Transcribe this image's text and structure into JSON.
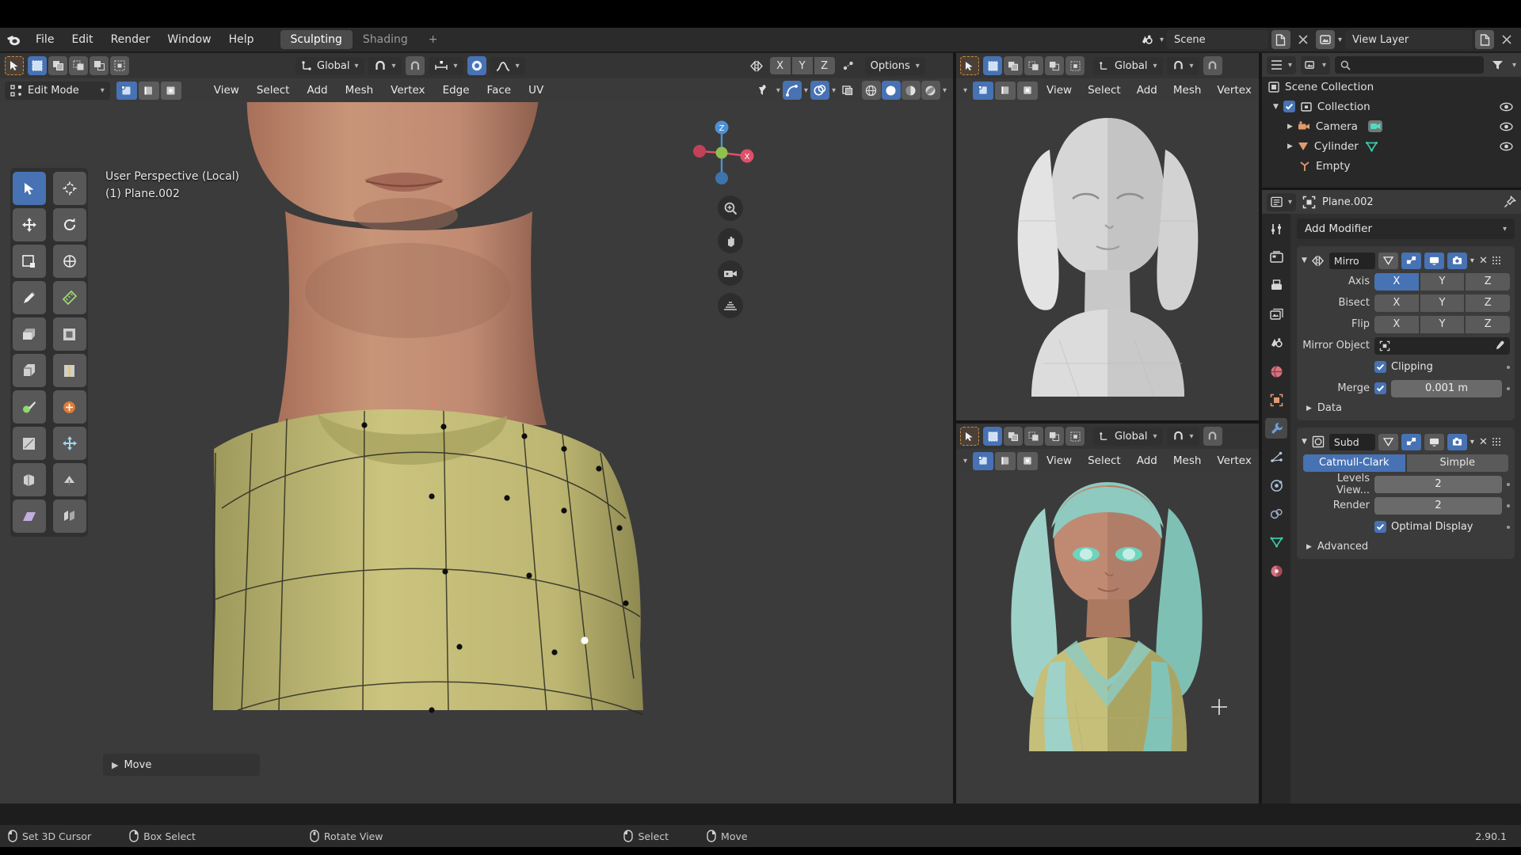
{
  "app": {
    "name": "Blender",
    "version": "2.90.1"
  },
  "topbar": {
    "menus": [
      "File",
      "Edit",
      "Render",
      "Window",
      "Help"
    ],
    "workspaces": [
      {
        "label": "Sculpting",
        "active": true
      },
      {
        "label": "Shading",
        "active": false
      }
    ],
    "add_workspace": "+",
    "scene_field": "Scene",
    "viewlayer_field": "View Layer",
    "scene_icon": "scene-icon",
    "viewlayer_icon": "viewlayer-icon",
    "new_icon": "new-datablock-icon",
    "close_icon": "close-icon"
  },
  "viewport": {
    "tools_header": {
      "cursor_icon": "cursor-select-icon",
      "select_modes": [
        "set-select",
        "extend-select",
        "subtract-select",
        "invert-select",
        "intersect-select"
      ],
      "transform_orientation": "Global",
      "snap_icon": "magnet-icon",
      "snap_target": "snap-increment-icon",
      "proportional_icon": "proportional-editing-icon",
      "falloff_icon": "smooth-falloff-icon",
      "mirror_icon": "mirror-icon",
      "mirror_axes": [
        "X",
        "Y",
        "Z"
      ],
      "autom_icon": "automerge-icon",
      "options_label": "Options"
    },
    "header": {
      "mode": "Edit Mode",
      "select_modes": [
        "vertex-select",
        "edge-select",
        "face-select"
      ],
      "menus": [
        "View",
        "Select",
        "Add",
        "Mesh",
        "Vertex",
        "Edge",
        "Face",
        "UV"
      ],
      "overlay_icons": [
        "visibility-icon",
        "show-gizmo-icon",
        "show-overlays-icon",
        "xray-icon"
      ],
      "shading_modes": [
        "wireframe-shading",
        "solid-shading",
        "material-shading",
        "rendered-shading"
      ]
    },
    "overlay_text": {
      "perspective": "User Perspective (Local)",
      "object": "(1) Plane.002"
    },
    "toolbar_tools": [
      "tweak-tool",
      "cursor-tool",
      "move-tool",
      "rotate-tool",
      "scale-tool",
      "transform-tool",
      "annotate-tool",
      "measure-tool",
      "extrude-region-tool",
      "inset-faces-tool",
      "bevel-tool",
      "loop-cut-tool",
      "knife-tool",
      "poly-build-tool",
      "spin-tool",
      "smooth-tool",
      "edge-slide-tool",
      "shrink-fatten-tool",
      "shear-tool",
      "rip-region-tool"
    ],
    "gizmo_axes": [
      "X",
      "Y",
      "Z"
    ],
    "nav_buttons": [
      "zoom-icon",
      "pan-icon",
      "camera-view-icon",
      "ortho-persp-icon"
    ],
    "operator_panel": "Move"
  },
  "viewport_small_top": {
    "transform_orientation": "Global",
    "menus": [
      "View",
      "Select",
      "Add",
      "Mesh",
      "Vertex"
    ]
  },
  "viewport_small_bottom": {
    "transform_orientation": "Global",
    "menus": [
      "View",
      "Select",
      "Add",
      "Mesh",
      "Vertex"
    ]
  },
  "outliner": {
    "search_placeholder": "",
    "display_mode_icon": "outliner-display-icon",
    "filter_icon": "filter-icon",
    "rows": [
      {
        "label": "Scene Collection",
        "indent": 0,
        "icon": "scene-collection-icon",
        "checkbox": false,
        "eye": false
      },
      {
        "label": "Collection",
        "indent": 1,
        "icon": "collection-icon",
        "checkbox": true,
        "eye": true
      },
      {
        "label": "Camera",
        "indent": 2,
        "icon": "camera-icon",
        "checkbox": false,
        "eye": true,
        "data_icon": "camera-data-icon"
      },
      {
        "label": "Cylinder",
        "indent": 2,
        "icon": "mesh-object-icon",
        "checkbox": false,
        "eye": true,
        "data_icon": "mesh-data-icon"
      },
      {
        "label": "Empty",
        "indent": 2,
        "icon": "empty-axes-icon",
        "checkbox": false,
        "eye": false
      }
    ]
  },
  "properties": {
    "breadcrumb_object": "Plane.002",
    "pin_icon": "pin-icon",
    "editor_icon": "properties-editor-icon",
    "tabs": [
      {
        "name": "tool-tab",
        "on": false
      },
      {
        "name": "render-tab",
        "on": false
      },
      {
        "name": "output-tab",
        "on": false
      },
      {
        "name": "view-layer-tab",
        "on": false
      },
      {
        "name": "scene-tab",
        "on": false
      },
      {
        "name": "world-tab",
        "on": false
      },
      {
        "name": "object-tab",
        "on": false
      },
      {
        "name": "modifier-tab",
        "on": true
      },
      {
        "name": "particles-tab",
        "on": false
      },
      {
        "name": "physics-tab",
        "on": false
      },
      {
        "name": "constraints-tab",
        "on": false
      },
      {
        "name": "object-data-tab",
        "on": false
      },
      {
        "name": "material-tab",
        "on": false
      }
    ],
    "add_modifier": "Add Modifier",
    "modifiers": [
      {
        "name": "Mirro",
        "full_name": "Mirror",
        "icon": "mirror-modifier-icon",
        "toggles": [
          {
            "name": "on-cage-toggle",
            "on": false
          },
          {
            "name": "edit-mode-toggle",
            "on": true
          },
          {
            "name": "realtime-toggle",
            "on": true
          },
          {
            "name": "render-toggle",
            "on": true
          }
        ],
        "rows": [
          {
            "label": "Axis",
            "type": "segmented",
            "options": [
              "X",
              "Y",
              "Z"
            ],
            "selected": [
              "X"
            ]
          },
          {
            "label": "Bisect",
            "type": "segmented",
            "options": [
              "X",
              "Y",
              "Z"
            ],
            "selected": []
          },
          {
            "label": "Flip",
            "type": "segmented",
            "options": [
              "X",
              "Y",
              "Z"
            ],
            "selected": []
          }
        ],
        "mirror_object": {
          "label": "Mirror Object",
          "value": "",
          "eyedropper": "eyedropper-icon"
        },
        "clipping": {
          "label": "Clipping",
          "checked": true
        },
        "merge": {
          "label": "Merge",
          "checked": true,
          "value": "0.001 m"
        },
        "data_section": "Data"
      },
      {
        "name": "Subd",
        "full_name": "Subdivision",
        "icon": "subdivision-modifier-icon",
        "toggles": [
          {
            "name": "on-cage-toggle",
            "on": false
          },
          {
            "name": "edit-mode-toggle",
            "on": true
          },
          {
            "name": "realtime-toggle",
            "on": false
          },
          {
            "name": "render-toggle",
            "on": true
          }
        ],
        "algorithm": {
          "options": [
            "Catmull-Clark",
            "Simple"
          ],
          "selected": "Catmull-Clark"
        },
        "levels_viewport": {
          "label": "Levels View...",
          "value": "2"
        },
        "render": {
          "label": "Render",
          "value": "2"
        },
        "optimal_display": {
          "label": "Optimal Display",
          "checked": true
        },
        "advanced_section": "Advanced"
      }
    ]
  },
  "status_bar": {
    "items": [
      {
        "icon": "mouse-left-icon",
        "label": "Set 3D Cursor"
      },
      {
        "icon": "mouse-right-icon",
        "label": "Box Select"
      },
      {
        "icon": "mouse-middle-icon",
        "label": "Rotate View"
      },
      {
        "icon": "mouse-left-icon",
        "label": "Select"
      },
      {
        "icon": "mouse-right-icon",
        "label": "Move"
      }
    ],
    "version": "2.90.1"
  },
  "colors": {
    "accent_blue": "#4772b3",
    "bg_dark": "#1d1d1d",
    "bg_panel": "#303030",
    "bg_header": "#3a3a3a",
    "viewport_bg": "#3b3b3b",
    "skin": "#c08a72",
    "shirt": "#c5bf7a",
    "hair_teal": "#8fcbc0",
    "axis_x": "#e0506a",
    "axis_y": "#8fc04f",
    "axis_z": "#4f90d0"
  }
}
